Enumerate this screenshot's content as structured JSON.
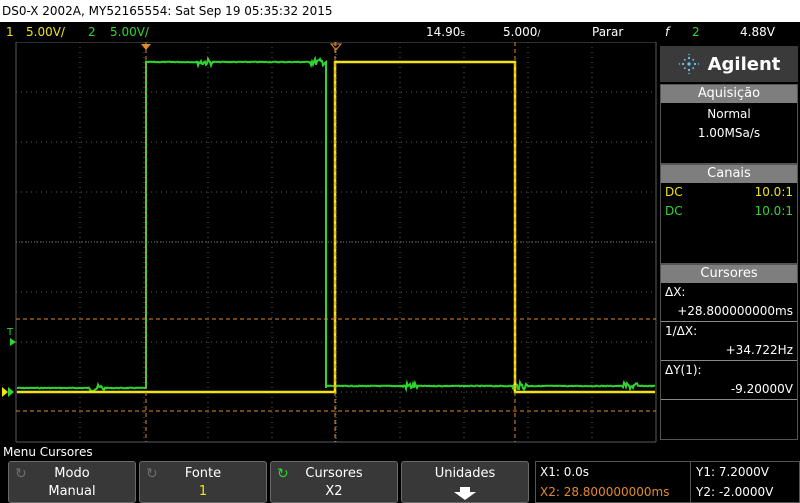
{
  "title": "DS0-X 2002A, MY52165554: Sat Sep 19 05:35:32 2015",
  "status": {
    "ch1_num": "1",
    "ch1_scale": "5.00V/",
    "ch2_num": "2",
    "ch2_scale": "5.00V/",
    "delay": "14.90",
    "delay_unit": "s",
    "timebase": "5.000",
    "timebase_unit": "/",
    "run_state": "Parar",
    "trigger_symbol": "f",
    "trigger_channel": "2",
    "trigger_level": "4.88V"
  },
  "markers": {
    "trigger_level": "T"
  },
  "brand": {
    "name": "Agilent"
  },
  "acquisition": {
    "header": "Aquisição",
    "mode": "Normal",
    "rate": "1.00MSa/s"
  },
  "channels": {
    "header": "Canais",
    "rows": [
      {
        "coupling": "DC",
        "probe": "10.0:1",
        "color": "#f2e411"
      },
      {
        "coupling": "DC",
        "probe": "10.0:1",
        "color": "#2fd62f"
      }
    ]
  },
  "cursors": {
    "header": "Cursores",
    "dx_label": "ΔX:",
    "dx_value": "+28.800000000ms",
    "inv_dx_label": "1/ΔX:",
    "inv_dx_value": "+34.722Hz",
    "dy_label": "ΔY(1):",
    "dy_value": "-9.20000V"
  },
  "menu": {
    "title": "Menu Cursores",
    "softkeys": [
      {
        "label": "Modo",
        "value": "Manual"
      },
      {
        "label": "Fonte",
        "value": "1"
      },
      {
        "label": "Cursores",
        "value": "X2"
      },
      {
        "label": "Unidades",
        "value": ""
      }
    ]
  },
  "readouts": {
    "x1": "X1: 0.0s",
    "x2": "X2: 28.800000000ms",
    "y1": "Y1: 7.2000V",
    "y2": "Y2: -2.0000V"
  },
  "colors": {
    "ch1": "#f2e411",
    "ch2": "#2fd62f",
    "cursor": "#e08a2c",
    "grid": "#5a5a5a"
  }
}
